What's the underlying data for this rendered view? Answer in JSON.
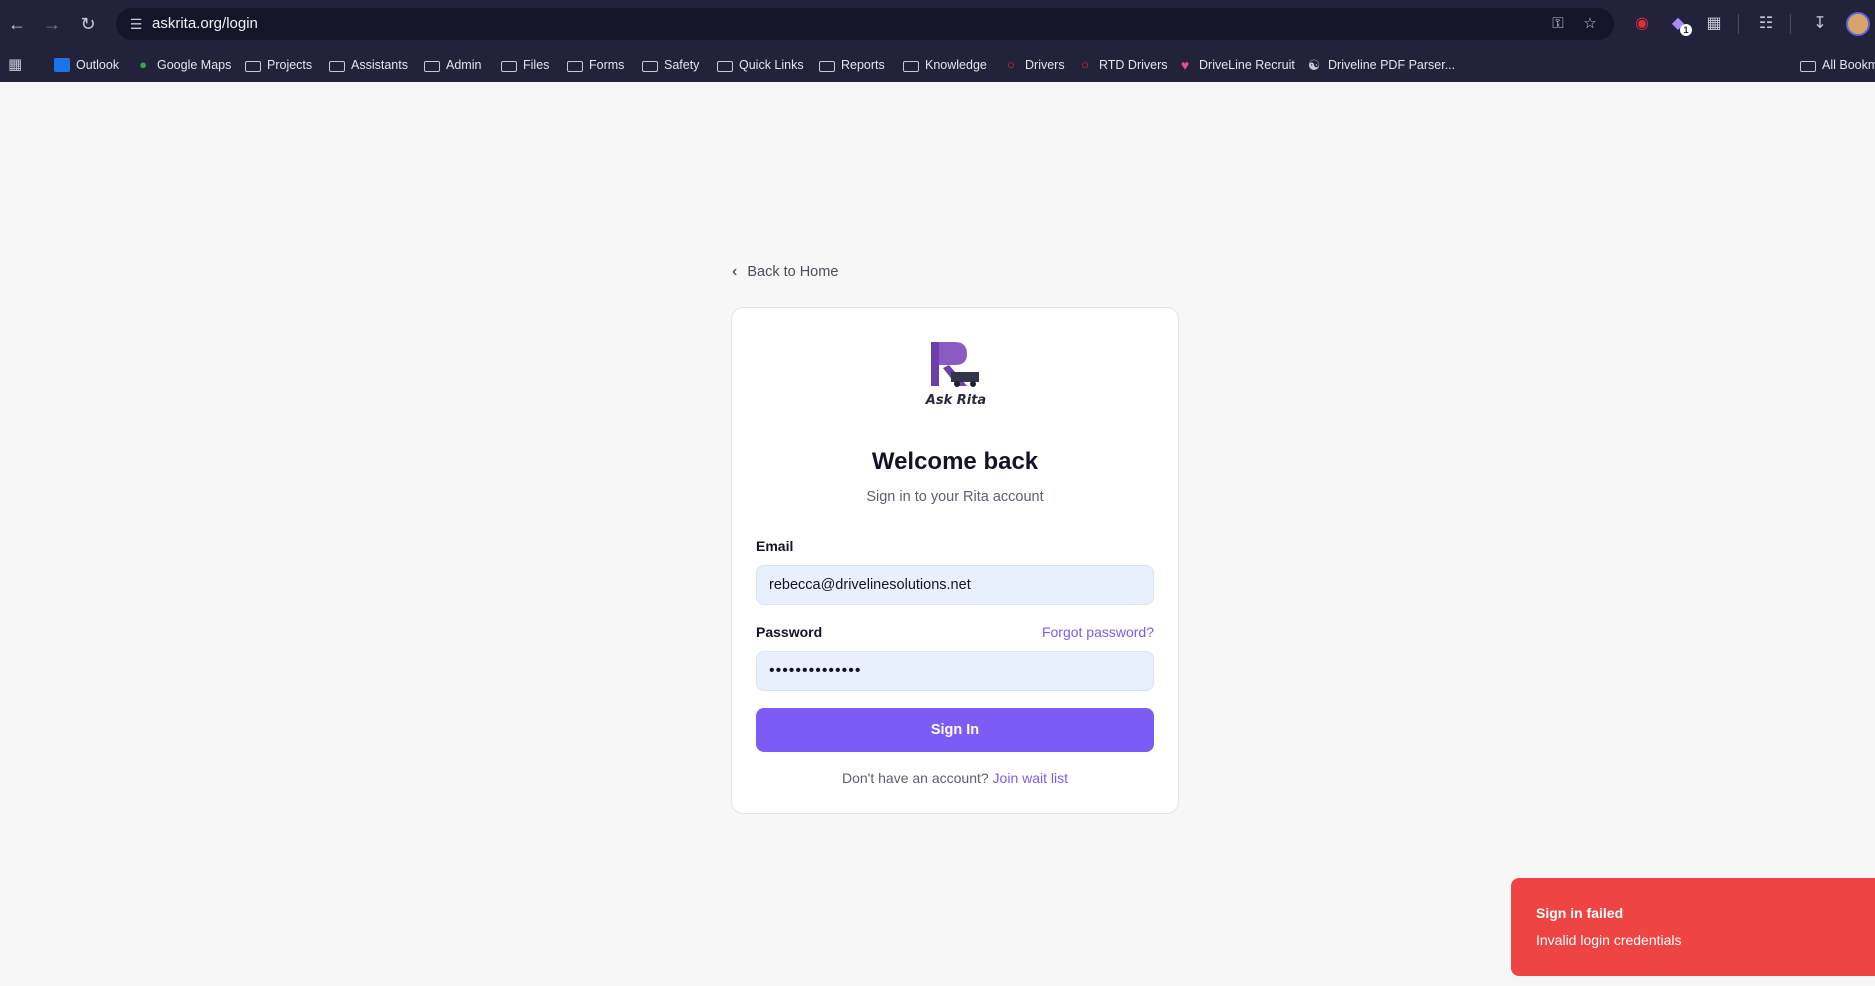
{
  "browser": {
    "url": "askrita.org/login",
    "extension_badge": "1",
    "bookmarks": [
      {
        "label": "Outlook",
        "icon": "outlook-icon"
      },
      {
        "label": "Google Maps",
        "icon": "maps-pin-icon"
      },
      {
        "label": "Projects",
        "icon": "folder-icon"
      },
      {
        "label": "Assistants",
        "icon": "folder-icon"
      },
      {
        "label": "Admin",
        "icon": "folder-icon"
      },
      {
        "label": "Files",
        "icon": "folder-icon"
      },
      {
        "label": "Forms",
        "icon": "folder-icon"
      },
      {
        "label": "Safety",
        "icon": "folder-icon"
      },
      {
        "label": "Quick Links",
        "icon": "folder-icon"
      },
      {
        "label": "Reports",
        "icon": "folder-icon"
      },
      {
        "label": "Knowledge",
        "icon": "folder-icon"
      },
      {
        "label": "Drivers",
        "icon": "pin-icon"
      },
      {
        "label": "RTD Drivers",
        "icon": "pin-icon"
      },
      {
        "label": "DriveLine Recruit",
        "icon": "heart-icon"
      },
      {
        "label": "Driveline PDF Parser...",
        "icon": "globe-icon"
      }
    ],
    "all_bookmarks_label": "All Bookm"
  },
  "page": {
    "back_label": "Back to Home",
    "logo_text": "Ask Rita",
    "title": "Welcome back",
    "subtitle": "Sign in to your Rita account",
    "email_label": "Email",
    "email_value": "rebecca@drivelinesolutions.net",
    "password_label": "Password",
    "forgot_label": "Forgot password?",
    "password_mask": "••••••••••••••",
    "signin_label": "Sign In",
    "footer_text": "Don't have an account?",
    "footer_link": "Join wait list"
  },
  "toast": {
    "title": "Sign in failed",
    "message": "Invalid login credentials"
  },
  "colors": {
    "accent": "#7c5cf5",
    "error": "#ef4444",
    "chrome": "#22223a"
  }
}
